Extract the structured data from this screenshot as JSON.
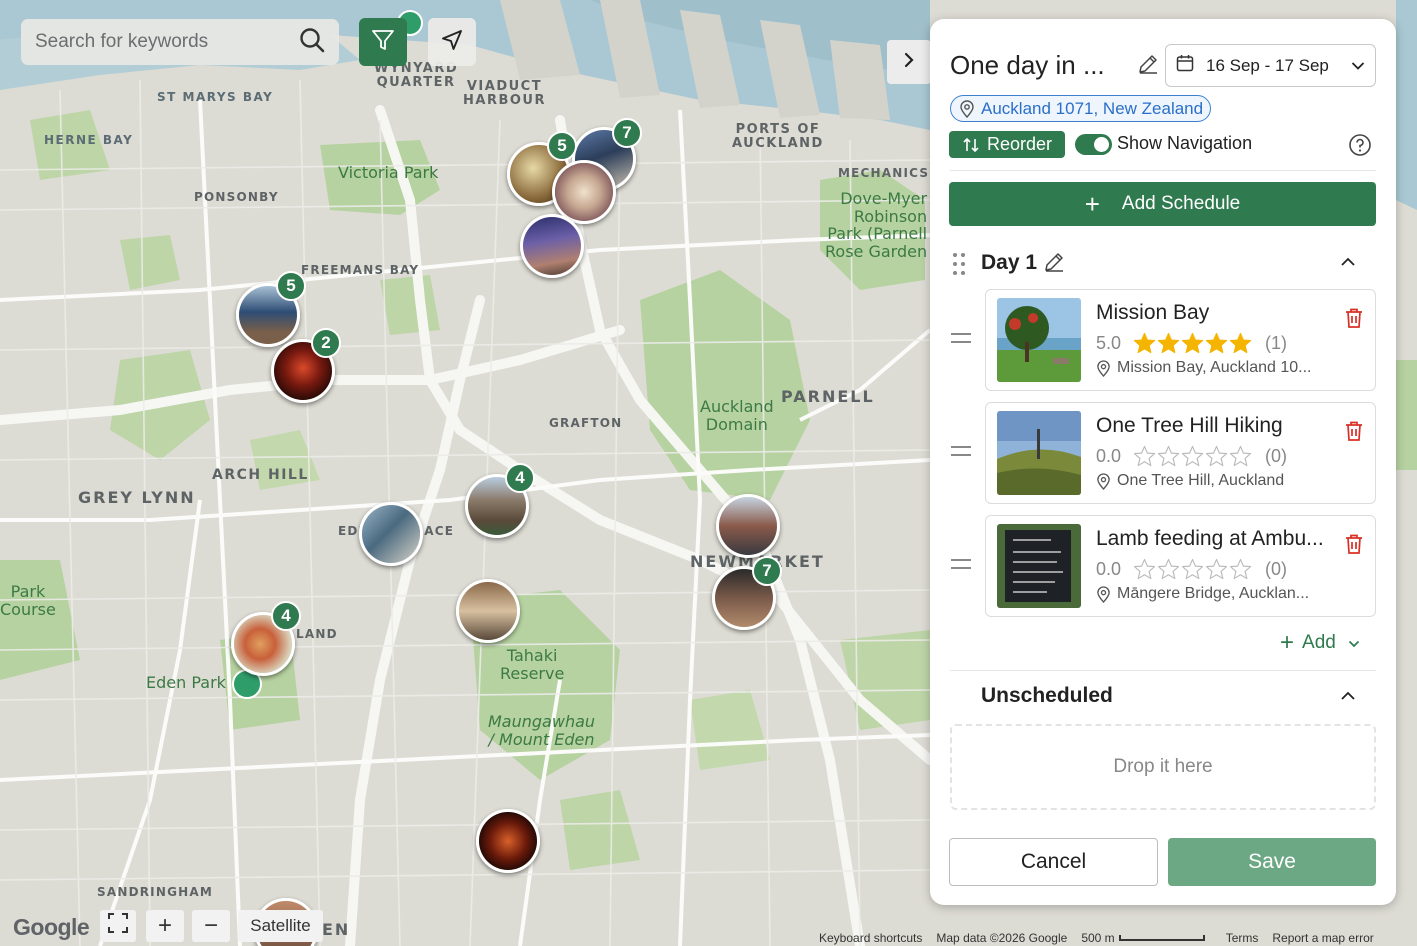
{
  "search": {
    "placeholder": "Search for keywords"
  },
  "map": {
    "labels": {
      "st_marys_bay": "ST MARYS BAY",
      "herne_bay": "HERNE BAY",
      "ponsonby": "PONSONBY",
      "freemans_bay": "FREEMANS BAY",
      "wynyard": "WYNYARD\nQUARTER",
      "viaduct": "VIADUCT\nHARBOUR",
      "ports": "PORTS OF\nAUCKLAND",
      "mechanics": "MECHANICS",
      "victoria_park": "Victoria Park",
      "dove_myer": "Dove-Myer\nRobinson\nPark (Parnell\nRose Garden",
      "parnell": "PARNELL",
      "auckland_domain": "Auckland\nDomain",
      "grafton": "GRAFTON",
      "arch_hill": "ARCH HILL",
      "grey_lynn": "GREY LYNN",
      "newmarket": "NEWMARKET",
      "park_course": "Park\nCourse",
      "eden_park": "Eden Park",
      "tahaki": "Tahaki\nReserve",
      "mount_eden": "Maungawhau\n/ Mount Eden",
      "sandringham": "SANDRINGHAM",
      "eden_terrace": "EDEN TERRACE",
      "land_suffix": "LAND",
      "en_suffix": "EN"
    },
    "clusters": [
      "5",
      "7",
      "5",
      "2",
      "4",
      "7",
      "4"
    ],
    "google_logo": "Google",
    "satellite_label": "Satellite",
    "zoom_in": "+",
    "zoom_out": "−",
    "attribution": {
      "shortcuts": "Keyboard shortcuts",
      "map_data": "Map data ©2026 Google",
      "scale": "500 m",
      "terms": "Terms",
      "report": "Report a map error"
    }
  },
  "panel": {
    "title": "One day in ...",
    "date_range": "16 Sep - 17 Sep",
    "location": "Auckland 1071, New Zealand",
    "reorder_label": "Reorder",
    "show_navigation_label": "Show Navigation",
    "show_navigation_on": true,
    "add_schedule_label": "Add Schedule",
    "day_title": "Day 1",
    "items": [
      {
        "name": "Mission Bay",
        "rating": "5.0",
        "rating_value": 5,
        "reviews": "(1)",
        "address": "Mission Bay, Auckland 10..."
      },
      {
        "name": "One Tree Hill Hiking",
        "rating": "0.0",
        "rating_value": 0,
        "reviews": "(0)",
        "address": "One Tree Hill, Auckland"
      },
      {
        "name": "Lamb feeding at Ambu...",
        "rating": "0.0",
        "rating_value": 0,
        "reviews": "(0)",
        "address": "Māngere Bridge, Aucklan..."
      }
    ],
    "add_label": "Add",
    "unscheduled_title": "Unscheduled",
    "dropzone_text": "Drop it here",
    "cancel_label": "Cancel",
    "save_label": "Save"
  },
  "colors": {
    "primary_green": "#2f7a4e",
    "save_green": "#6ba883",
    "star_gold": "#f5b400",
    "delete_red": "#d93025",
    "link_blue": "#2a6fc9"
  }
}
